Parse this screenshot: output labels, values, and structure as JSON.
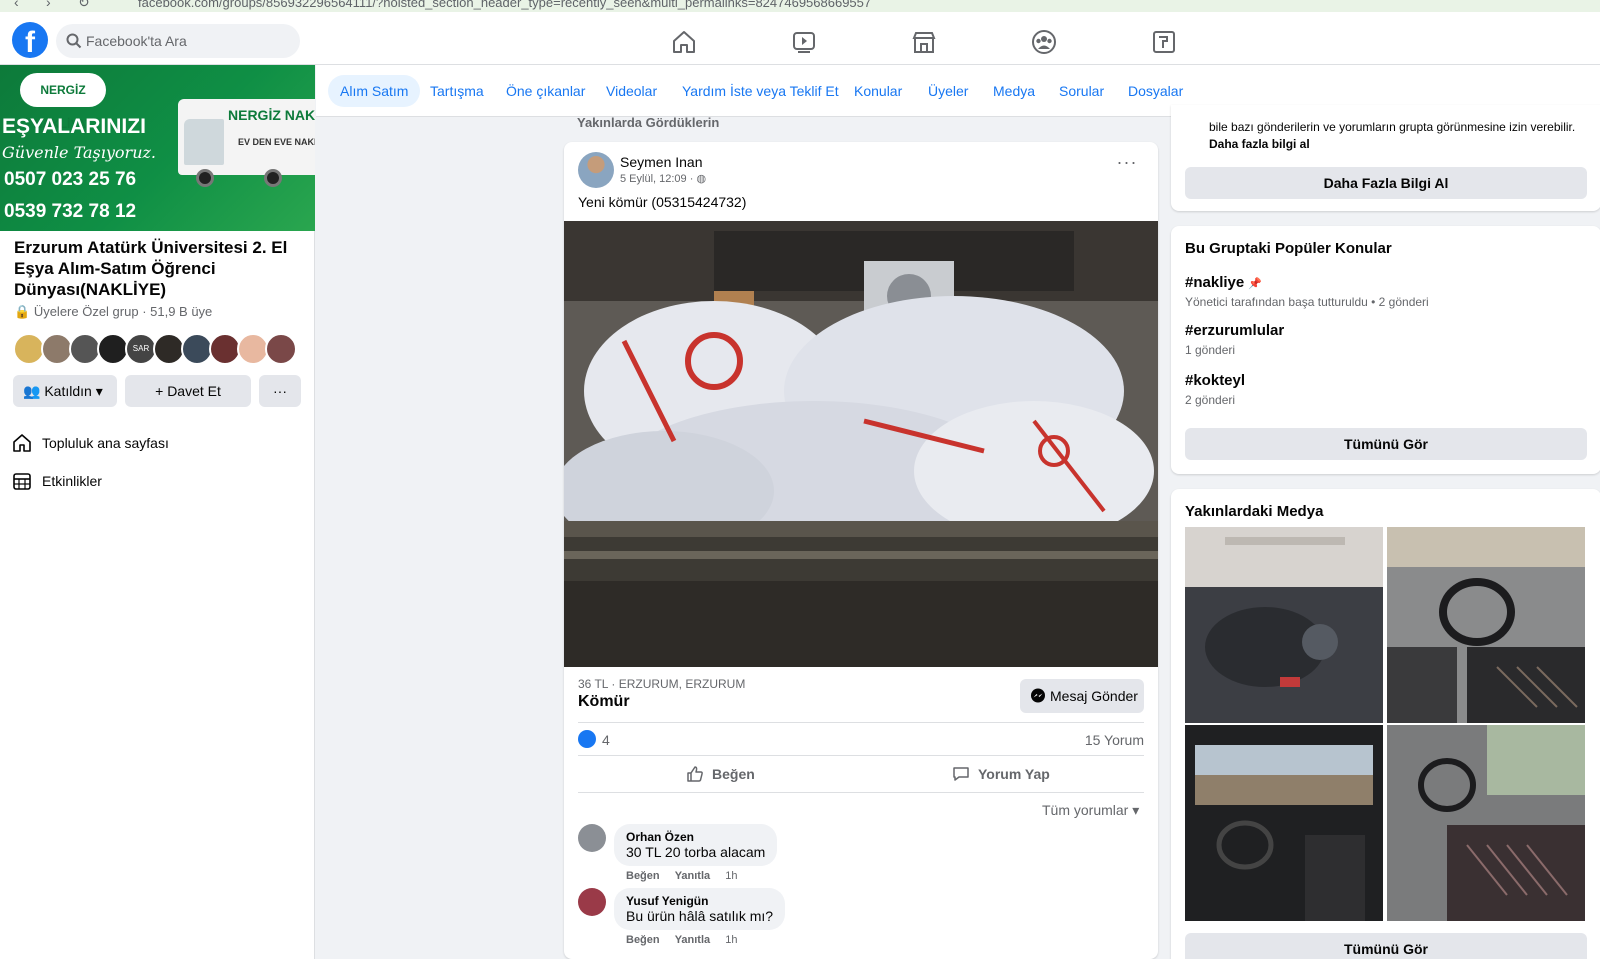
{
  "browser": {
    "url": "facebook.com/groups/856932296564111/?hoisted_section_header_type=recently_seen&multi_permalinks=8247469568669557"
  },
  "header": {
    "logo": "f",
    "search_placeholder": "Facebook'ta Ara",
    "nav_icons": [
      "home-icon",
      "watch-icon",
      "marketplace-icon",
      "groups-icon",
      "gaming-icon"
    ]
  },
  "sidebar": {
    "banner": {
      "badge": "NERGİZ NAKLİYAT",
      "line1": "EŞYALARINIZI",
      "line2": "Güvenle Taşıyoruz.",
      "phone1": "0507 023 25 76",
      "phone2": "0539 732 78 12",
      "truck_brand": "NERGİZ NAKLİYAT",
      "truck_sub": "EV DEN EVE NAKLİYAT"
    },
    "group_name": "Erzurum Atatürk Üniversitesi 2. El Eşya Alım-Satım Öğrenci Dünyası(NAKLİYE)",
    "group_meta": "Üyelere Özel grup · 51,9 B üye",
    "member_avatar_label": "SAR",
    "joined_label": "Katıldın",
    "invite_label": "Davet Et",
    "more_label": "···",
    "links": [
      {
        "label": "Topluluk ana sayfası",
        "icon": "home-icon"
      },
      {
        "label": "Etkinlikler",
        "icon": "calendar-icon"
      }
    ]
  },
  "tabs": [
    {
      "label": "Alım Satım",
      "active": true
    },
    {
      "label": "Tartışma"
    },
    {
      "label": "Öne çıkanlar"
    },
    {
      "label": "Videolar"
    },
    {
      "label": "Yardım İste veya Teklif Et"
    },
    {
      "label": "Konular"
    },
    {
      "label": "Üyeler"
    },
    {
      "label": "Medya"
    },
    {
      "label": "Sorular"
    },
    {
      "label": "Dosyalar"
    }
  ],
  "feed": {
    "section_title": "Yakınlarda Gördüklerin",
    "post": {
      "author": "Seymen Inan",
      "date": "5 Eylül, 12:09 ·",
      "text": "Yeni kömür (05315424732)",
      "price_location": "36 TL · ERZURUM, ERZURUM",
      "title": "Kömür",
      "message_button": "Mesaj Gönder",
      "like_count": "4",
      "comment_count": "15 Yorum",
      "like_action": "Beğen",
      "comment_action": "Yorum Yap",
      "sort_label": "Tüm yorumlar ▾",
      "comments": [
        {
          "name": "Orhan Özen",
          "text": "30 TL 20 torba alacam",
          "like": "Beğen",
          "reply": "Yanıtla",
          "time": "1h"
        },
        {
          "name": "Yusuf Yenigün",
          "text": "Bu ürün hâlâ satılık mı?",
          "like": "Beğen",
          "reply": "Yanıtla",
          "time": "1h"
        }
      ]
    }
  },
  "right": {
    "about": {
      "text": "bile bazı gönderilerin ve yorumların grupta görünmesine izin verebilir.",
      "link": "Daha fazla bilgi al",
      "button": "Daha Fazla Bilgi Al"
    },
    "topics": {
      "title": "Bu Gruptaki Popüler Konular",
      "items": [
        {
          "tag": "#nakliye",
          "sub": "Yönetici tarafından başa tutturuldu • 2 gönderi",
          "pinned": true
        },
        {
          "tag": "#erzurumlular",
          "sub": "1 gönderi"
        },
        {
          "tag": "#kokteyl",
          "sub": "2 gönderi"
        }
      ],
      "button": "Tümünü Gör"
    },
    "media": {
      "title": "Yakınlardaki Medya",
      "button": "Tümünü Gör"
    }
  },
  "colors": {
    "accent": "#1877f2",
    "banner_green": "#0f8f45",
    "page_bg": "#f0f2f5"
  }
}
